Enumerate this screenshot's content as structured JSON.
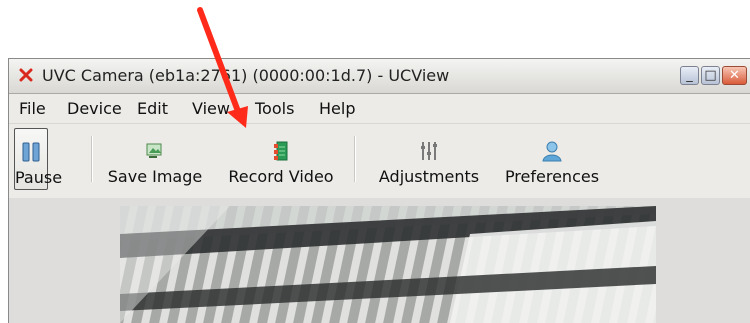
{
  "window": {
    "title": "UVC Camera (eb1a:2761) (0000:00:1d.7) - UCView",
    "controls": {
      "minimize": "_",
      "maximize": "□",
      "close": "✕"
    },
    "icon": "red-x-icon"
  },
  "menubar": {
    "items": [
      {
        "label": "File"
      },
      {
        "label": "Device"
      },
      {
        "label": "Edit"
      },
      {
        "label": "View"
      },
      {
        "label": "Tools"
      },
      {
        "label": "Help"
      }
    ]
  },
  "toolbar": {
    "pause": {
      "label": "Pause",
      "icon": "pause-icon",
      "pressed": true
    },
    "save_image": {
      "label": "Save Image",
      "icon": "save-image-icon"
    },
    "record_video": {
      "label": "Record Video",
      "icon": "record-video-icon"
    },
    "adjustments": {
      "label": "Adjustments",
      "icon": "adjustments-icon"
    },
    "preferences": {
      "label": "Preferences",
      "icon": "preferences-icon"
    }
  },
  "viewer": {
    "content": "camera-preview"
  },
  "annotation": {
    "arrow_color": "#ff2a1a",
    "points_to": "record-video-button"
  }
}
